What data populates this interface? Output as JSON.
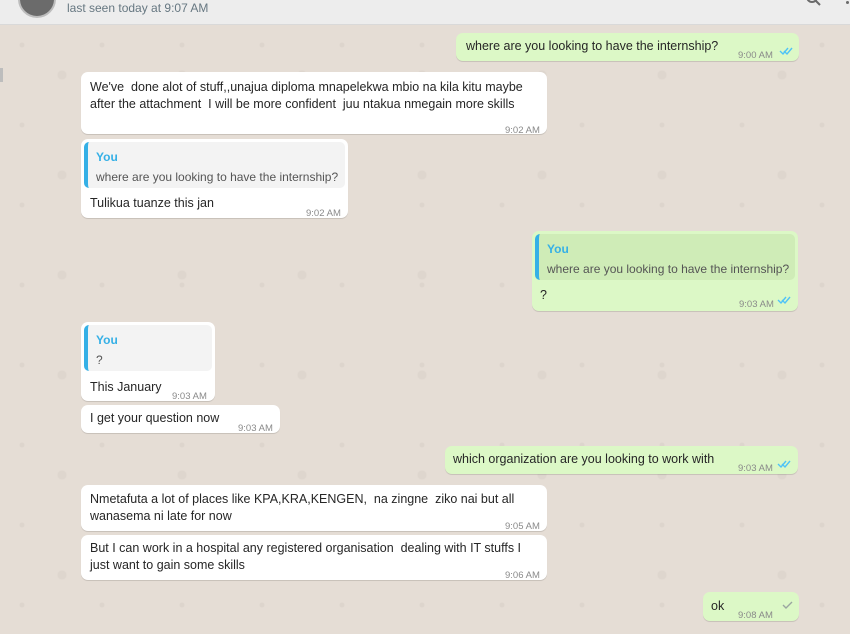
{
  "header": {
    "status": "last seen today at 9:07 AM"
  },
  "messages": [
    {
      "text": "where are you looking to have the internship?",
      "time": "9:00 AM"
    },
    {
      "text": "We've  done alot of stuff,,unajua diploma mnapelekwa mbio na kila kitu maybe\nafter the attachment  I will be more confident  juu ntakua nmegain more skills",
      "time": "9:02 AM"
    },
    {
      "quote_author": "You",
      "quote_text": "where are you looking to have the internship?",
      "text": "Tulikua tuanze this jan",
      "time": "9:02 AM"
    },
    {
      "quote_author": "You",
      "quote_text": "where are you looking to have the internship?",
      "text": "?",
      "time": "9:03 AM"
    },
    {
      "quote_author": "You",
      "quote_text": "?",
      "text": "This January",
      "time": "9:03 AM"
    },
    {
      "text": "I get your question now",
      "time": "9:03 AM"
    },
    {
      "text": "which organization are you looking to work with",
      "time": "9:03 AM"
    },
    {
      "text": "Nmetafuta a lot of places like KPA,KRA,KENGEN,  na zingne  ziko nai but all\nwanasema ni late for now",
      "time": "9:05 AM"
    },
    {
      "text": "But I can work in a hospital any registered organisation  dealing with IT stuffs I\njust want to gain some skills",
      "time": "9:06 AM"
    },
    {
      "text": "ok",
      "time": "9:08 AM"
    }
  ],
  "colors": {
    "outgoing": "#dcf8c6",
    "incoming": "#ffffff",
    "tick_read": "#4fc3f7",
    "quote_accent": "#35b0e6"
  },
  "icons": {
    "read": "double-check-icon",
    "sent": "single-check-icon"
  }
}
